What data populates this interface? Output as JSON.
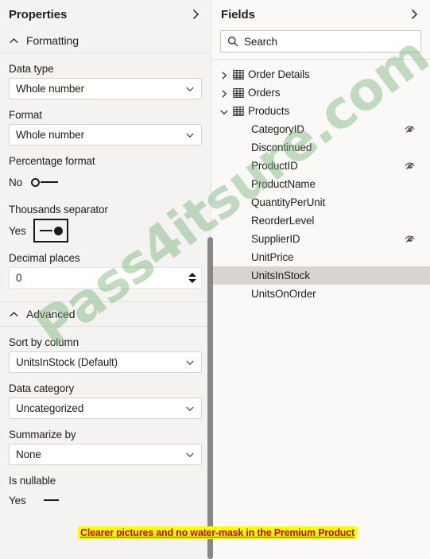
{
  "properties": {
    "title": "Properties",
    "collapse_icon": "chevron-right-icon",
    "sections": [
      {
        "label": "Formatting",
        "chevron": "chevron-up-icon"
      },
      {
        "label": "Advanced",
        "chevron": "chevron-up-icon"
      }
    ],
    "formatting": {
      "data_type": {
        "label": "Data type",
        "value": "Whole number"
      },
      "format": {
        "label": "Format",
        "value": "Whole number"
      },
      "percentage_format": {
        "label": "Percentage format",
        "state": "No",
        "on": false
      },
      "thousands_separator": {
        "label": "Thousands separator",
        "state": "Yes",
        "on": true
      },
      "decimal_places": {
        "label": "Decimal places",
        "value": "0"
      }
    },
    "advanced": {
      "sort_by_column": {
        "label": "Sort by column",
        "value": "UnitsInStock (Default)"
      },
      "data_category": {
        "label": "Data category",
        "value": "Uncategorized"
      },
      "summarize_by": {
        "label": "Summarize by",
        "value": "None"
      },
      "is_nullable": {
        "label": "Is nullable",
        "state": "Yes",
        "on": false
      }
    }
  },
  "fields": {
    "title": "Fields",
    "collapse_icon": "chevron-right-icon",
    "search": {
      "placeholder": "Search",
      "value": "Search",
      "icon": "search-icon"
    },
    "tables": [
      {
        "name": "Order Details",
        "expanded": false,
        "chevron": "chevron-right-icon",
        "icon": "table-icon"
      },
      {
        "name": "Orders",
        "expanded": false,
        "chevron": "chevron-right-icon",
        "icon": "table-icon"
      },
      {
        "name": "Products",
        "expanded": true,
        "chevron": "chevron-down-icon",
        "icon": "table-icon"
      }
    ],
    "columns": [
      {
        "name": "CategoryID",
        "hidden": true,
        "selected": false
      },
      {
        "name": "Discontinued",
        "hidden": false,
        "selected": false
      },
      {
        "name": "ProductID",
        "hidden": true,
        "selected": false
      },
      {
        "name": "ProductName",
        "hidden": false,
        "selected": false
      },
      {
        "name": "QuantityPerUnit",
        "hidden": false,
        "selected": false
      },
      {
        "name": "ReorderLevel",
        "hidden": false,
        "selected": false
      },
      {
        "name": "SupplierID",
        "hidden": true,
        "selected": false
      },
      {
        "name": "UnitPrice",
        "hidden": false,
        "selected": false
      },
      {
        "name": "UnitsInStock",
        "hidden": false,
        "selected": true
      },
      {
        "name": "UnitsOnOrder",
        "hidden": false,
        "selected": false
      }
    ]
  },
  "overlay": {
    "watermark": "Pass4itsure.com",
    "annotation": "Clearer pictures and no water-mask in the Premium Product"
  },
  "colors": {
    "panel_bg": "#f4f3f2",
    "fields_bg": "#faf9f8",
    "selection": "#d8d4d0",
    "text": "#201f1e",
    "border": "#e3e1df",
    "scrollbar": "#8a8886",
    "annotation_bg": "#ffff00",
    "annotation_fg": "#cc0000",
    "watermark": "#78b478"
  }
}
